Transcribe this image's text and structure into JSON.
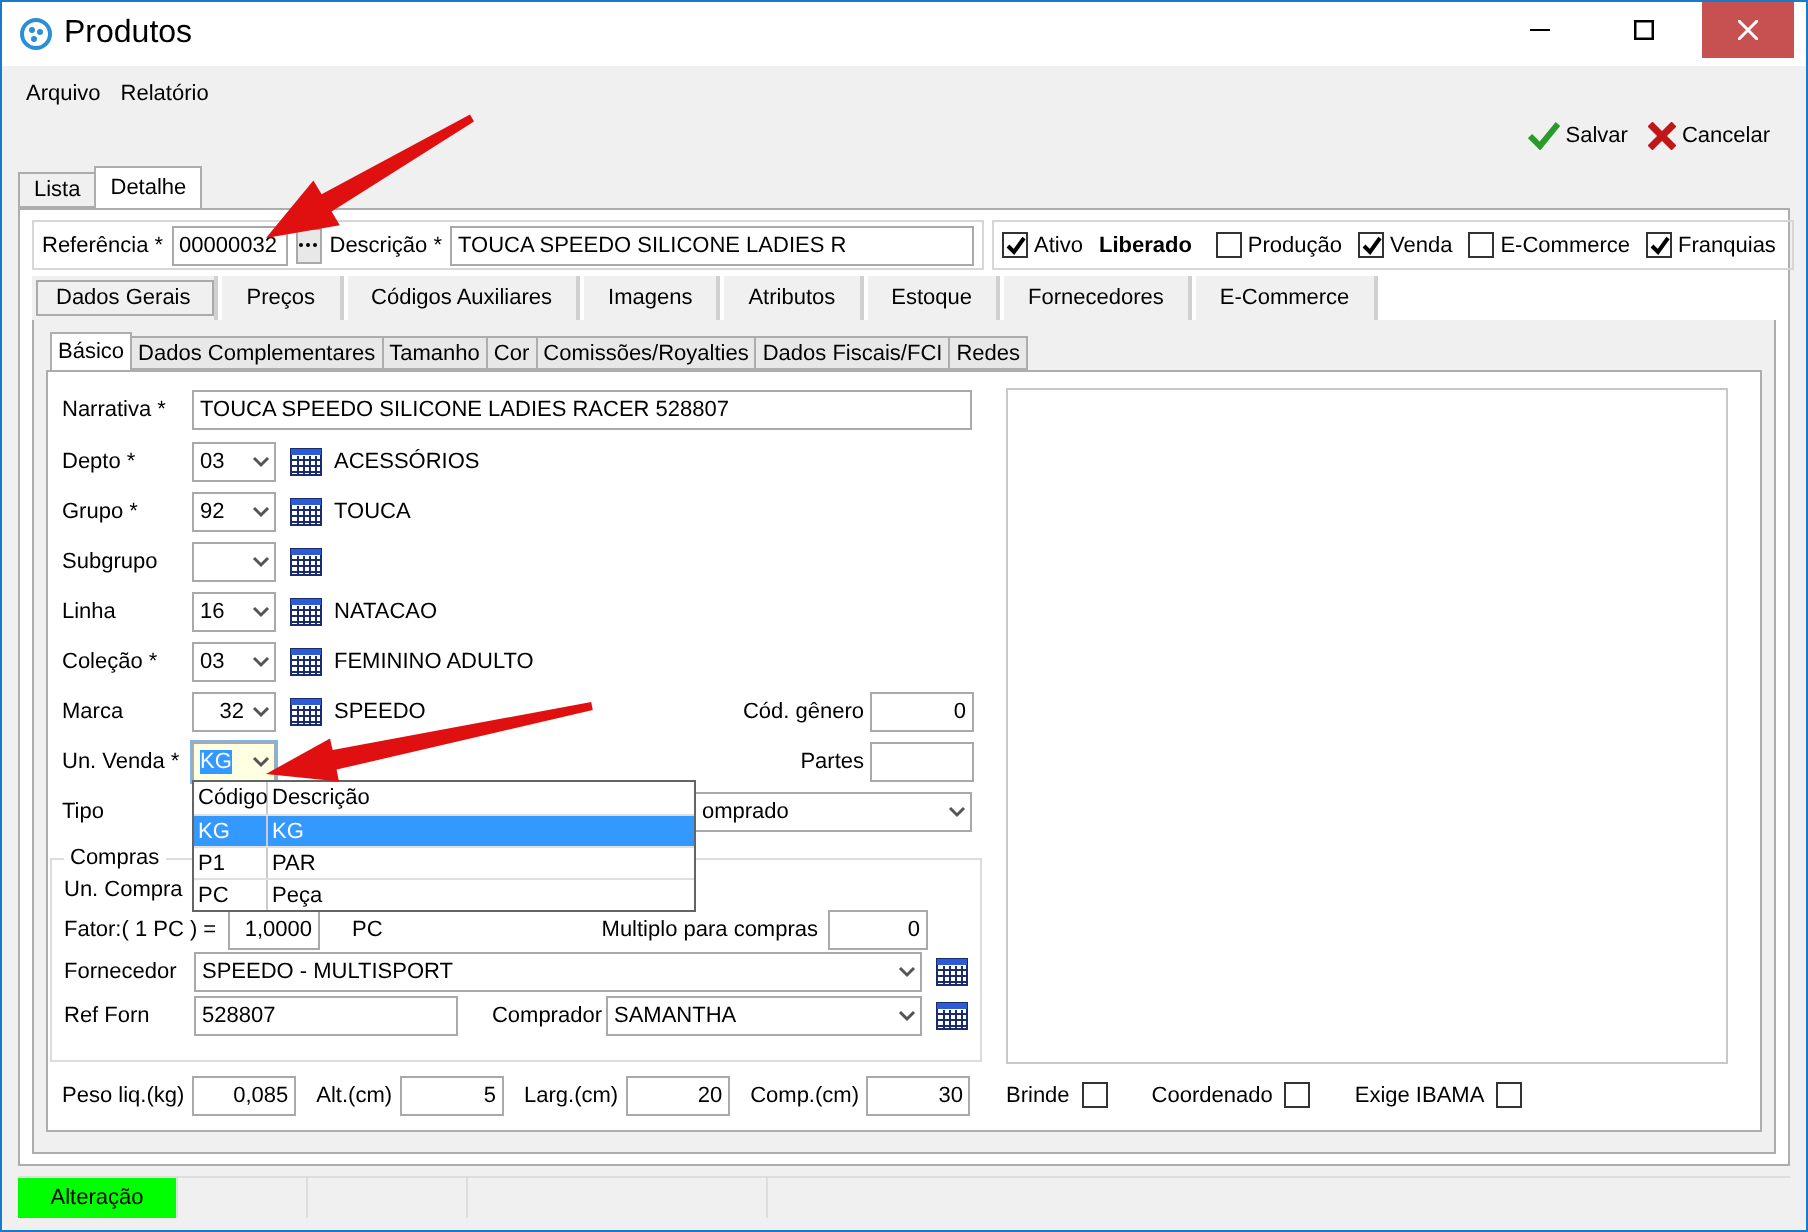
{
  "window": {
    "title": "Produtos"
  },
  "menu": [
    {
      "label": "Arquivo"
    },
    {
      "label": "Relatório"
    }
  ],
  "toolbar": [
    {
      "label": "Salvar",
      "kind": "save"
    },
    {
      "label": "Cancelar",
      "kind": "cancel"
    }
  ],
  "main_tabs": [
    {
      "label": "Lista",
      "selected": false
    },
    {
      "label": "Detalhe",
      "selected": true
    }
  ],
  "header": {
    "reference": {
      "label": "Referência *",
      "value": "00000032"
    },
    "description": {
      "label": "Descrição *",
      "value": "TOUCA SPEEDO SILICONE LADIES R"
    },
    "flags": [
      {
        "kind": "check",
        "label": "Ativo",
        "checked": true
      },
      {
        "kind": "status",
        "label": "Liberado"
      },
      {
        "kind": "check",
        "label": "Produção",
        "checked": false
      },
      {
        "kind": "check",
        "label": "Venda",
        "checked": true
      },
      {
        "kind": "check",
        "label": "E-Commerce",
        "checked": false
      },
      {
        "kind": "check",
        "label": "Franquias",
        "checked": true
      }
    ]
  },
  "section_tabs": [
    {
      "label": "Dados Gerais",
      "selected": true
    },
    {
      "label": "Preços",
      "selected": false
    },
    {
      "label": "Códigos Auxiliares",
      "selected": false
    },
    {
      "label": "Imagens",
      "selected": false
    },
    {
      "label": "Atributos",
      "selected": false
    },
    {
      "label": "Estoque",
      "selected": false
    },
    {
      "label": "Fornecedores",
      "selected": false
    },
    {
      "label": "E-Commerce",
      "selected": false
    }
  ],
  "sub_tabs": [
    {
      "label": "Básico",
      "selected": true
    },
    {
      "label": "Dados Complementares",
      "selected": false
    },
    {
      "label": "Tamanho",
      "selected": false
    },
    {
      "label": "Cor",
      "selected": false
    },
    {
      "label": "Comissões/Royalties",
      "selected": false
    },
    {
      "label": "Dados Fiscais/FCI",
      "selected": false
    },
    {
      "label": "Redes",
      "selected": false
    }
  ],
  "fields": [
    {
      "kind": "text",
      "label": "Narrativa *",
      "value": "TOUCA SPEEDO SILICONE LADIES RACER 528807"
    },
    {
      "kind": "lookup",
      "label": "Depto *",
      "code": "03",
      "description": "ACESSÓRIOS",
      "focused": false
    },
    {
      "kind": "lookup",
      "label": "Grupo *",
      "code": "92",
      "description": "TOUCA",
      "focused": false
    },
    {
      "kind": "lookup",
      "label": "Subgrupo",
      "focused": false
    },
    {
      "kind": "lookup",
      "label": "Linha",
      "code": "16",
      "description": "NATACAO",
      "focused": false
    },
    {
      "kind": "lookup",
      "label": "Coleção *",
      "code": "03",
      "description": "FEMININO ADULTO",
      "focused": false
    },
    {
      "kind": "lookup",
      "label": "Marca",
      "code": "32",
      "description": "SPEEDO",
      "focused": false,
      "extra": {
        "label": "Cód. gênero",
        "value": "0"
      }
    },
    {
      "kind": "lookup",
      "label": "Un. Venda *",
      "code": "KG",
      "focused": true,
      "extra": {
        "label": "Partes"
      }
    },
    {
      "kind": "select",
      "label": "Tipo",
      "value": "omprado"
    }
  ],
  "dropdown": {
    "columns": [
      "Código",
      "Descrição"
    ],
    "rows": [
      {
        "code": "KG",
        "description": "KG",
        "selected": true
      },
      {
        "code": "P1",
        "description": "PAR",
        "selected": false
      },
      {
        "code": "PC",
        "description": "Peça",
        "selected": false
      }
    ]
  },
  "purchases": {
    "title": "Compras",
    "unit_label": "Un. Compra",
    "factor_label": "Fator:( 1 PC ) =",
    "factor_value": "1,0000",
    "factor_unit": "PC",
    "multiple_label": "Multiplo para compras",
    "multiple_value": "0",
    "supplier_label": "Fornecedor",
    "supplier": "SPEEDO - MULTISPORT",
    "ref_label": "Ref Forn",
    "ref": "528807",
    "buyer_label": "Comprador",
    "buyer": "SAMANTHA"
  },
  "measures": [
    {
      "label": "Peso liq.(kg)",
      "value": "0,085"
    },
    {
      "label": "Alt.(cm)",
      "value": "5"
    },
    {
      "label": "Larg.(cm)",
      "value": "20"
    },
    {
      "label": "Comp.(cm)",
      "value": "30"
    }
  ],
  "options": [
    {
      "label": "Brinde",
      "checked": false
    },
    {
      "label": "Coordenado",
      "checked": false
    },
    {
      "label": "Exige IBAMA",
      "checked": false
    }
  ],
  "status_bar": [
    {
      "text": "Alteração",
      "color": "#00ff00"
    }
  ]
}
